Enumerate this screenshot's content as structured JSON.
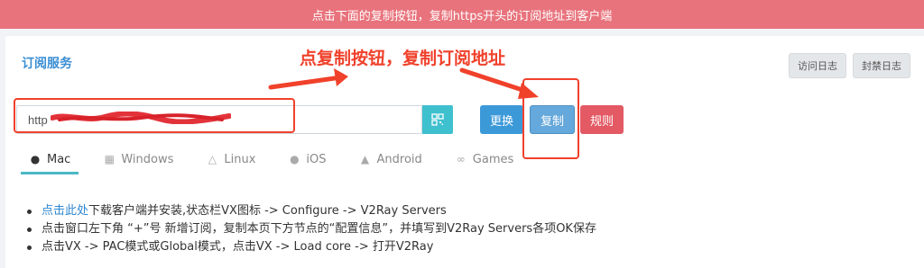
{
  "banner": {
    "text": "点击下面的复制按钮，复制https开头的订阅地址到客户端"
  },
  "card": {
    "title": "订阅服务"
  },
  "header_buttons": {
    "access_log": "访问日志",
    "ban_log": "封禁日志"
  },
  "annotation": {
    "text": "点复制按钮，复制订阅地址"
  },
  "subscription": {
    "url_value": "http"
  },
  "actions": {
    "change": "更换",
    "copy": "复制",
    "rules": "规则"
  },
  "tabs": [
    {
      "label": "Mac",
      "icon": "apple-icon"
    },
    {
      "label": "Windows",
      "icon": "windows-icon"
    },
    {
      "label": "Linux",
      "icon": "linux-icon"
    },
    {
      "label": "iOS",
      "icon": "apple-icon"
    },
    {
      "label": "Android",
      "icon": "android-icon"
    },
    {
      "label": "Games",
      "icon": "gamepad-icon"
    }
  ],
  "instructions": {
    "line1_link": "点击此处",
    "line1_rest": "下载客户端并安装,状态栏VX图标 -> Configure -> V2Ray Servers",
    "line2": "点击窗口左下角 “+”号 新增订阅，复制本页下方节点的“配置信息”，并填写到V2Ray Servers各项OK保存",
    "line3": "点击VX -> PAC模式或Global模式，点击VX -> Load core -> 打开V2Ray"
  },
  "colors": {
    "banner": "#e8737c",
    "accent": "#3a8ed3",
    "annotation": "#f0412b",
    "copy_button": "#65a8db",
    "rules_button": "#e35964"
  }
}
